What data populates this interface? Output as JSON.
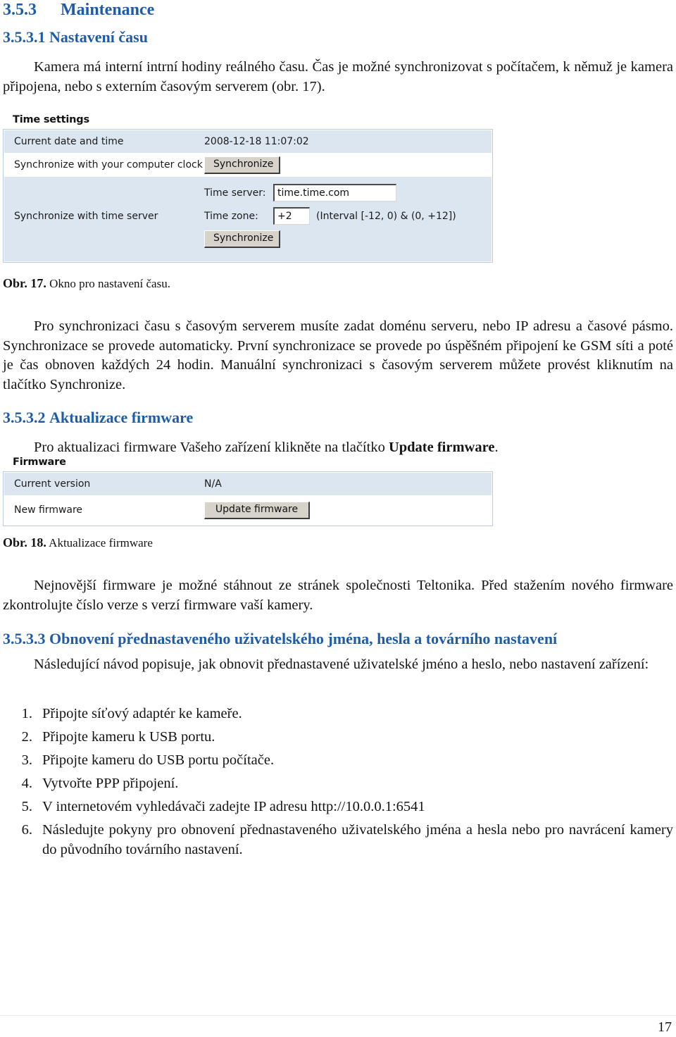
{
  "sections": {
    "maintenance": {
      "number": "3.5.3",
      "title": "Maintenance"
    },
    "time_settings": {
      "number": "3.5.3.1",
      "title": "Nastavení času"
    },
    "firmware_update": {
      "number": "3.5.3.2",
      "title": "Aktualizace firmware"
    },
    "factory_restore": {
      "number": "3.5.3.3",
      "title": "Obnovení přednastaveného uživatelského jména, hesla a továrního nastavení"
    }
  },
  "paragraphs": {
    "intro": "Kamera má interní intrní hodiny reálného času. Čas je možné synchronizovat s počítačem, k němuž je kamera připojena, nebo s externím časovým serverem (obr. 17).",
    "sync": "Pro synchronizaci času s časovým serverem musíte zadat doménu serveru, nebo IP adresu a časové pásmo. Synchronizace se provede automaticky. První synchronizace se provede po úspěšném připojení ke GSM síti a poté je čas obnoven každých 24 hodin. Manuální synchronizaci s časovým serverem můžete provést kliknutím na tlačítko Synchronize.",
    "firmware_intro_before": "Pro aktualizaci firmware Vašeho zařízení klikněte na tlačítko ",
    "firmware_intro_bold": "Update firmware",
    "firmware_intro_after": ".",
    "firmware_note": "Nejnovější firmware je možné stáhnout ze stránek společnosti Teltonika. Před stažením nového firmware zkontrolujte číslo verze s verzí firmware vaší kamery.",
    "restore_intro": "Následující návod popisuje, jak obnovit přednastavené uživatelské jméno a heslo, nebo nastavení zařízení:"
  },
  "captions": {
    "fig17": {
      "label": "Obr. 17.",
      "text": "Okno pro nastavení času."
    },
    "fig18": {
      "label": "Obr. 18.",
      "text": "Aktualizace firmware"
    }
  },
  "time_settings_panel": {
    "title": "Time settings",
    "rows": [
      {
        "label": "Current date and time",
        "value": "2008-12-18 11:07:02"
      },
      {
        "label": "Synchronize with your computer clock",
        "button": "Synchronize"
      },
      {
        "label": "Synchronize with time server"
      }
    ],
    "fields": {
      "time_server_label": "Time server:",
      "time_server_value": "time.time.com",
      "time_zone_label": "Time zone:",
      "time_zone_value": "+2",
      "time_zone_hint": "(Interval [-12, 0) & (0, +12])"
    },
    "sync_button": "Synchronize"
  },
  "firmware_panel": {
    "title": "Firmware",
    "rows": [
      {
        "label": "Current version",
        "value": "N/A"
      },
      {
        "label": "New firmware",
        "button": "Update firmware"
      }
    ]
  },
  "restore_steps": [
    {
      "num": "1.",
      "text": "Připojte síťový adaptér ke kameře."
    },
    {
      "num": "2.",
      "text": "Připojte kameru k USB portu."
    },
    {
      "num": "3.",
      "text": "Připojte kameru do USB portu počítače."
    },
    {
      "num": "4.",
      "text": "Vytvořte PPP připojení."
    },
    {
      "num": "5.",
      "text": "V internetovém vyhledávači zadejte IP adresu http://10.0.0.1:6541"
    },
    {
      "num": "6.",
      "text": "Následujte pokyny pro obnovení přednastaveného uživatelského jména a hesla nebo pro navrácení kamery do původního továrního nastavení."
    }
  ],
  "footer": {
    "page_number": "17"
  },
  "colors": {
    "heading_blue": "#1f5ca8",
    "panel_blue": "#dce6f1",
    "panel_border": "#b9cbdd",
    "button_face": "#d7d3cb"
  }
}
